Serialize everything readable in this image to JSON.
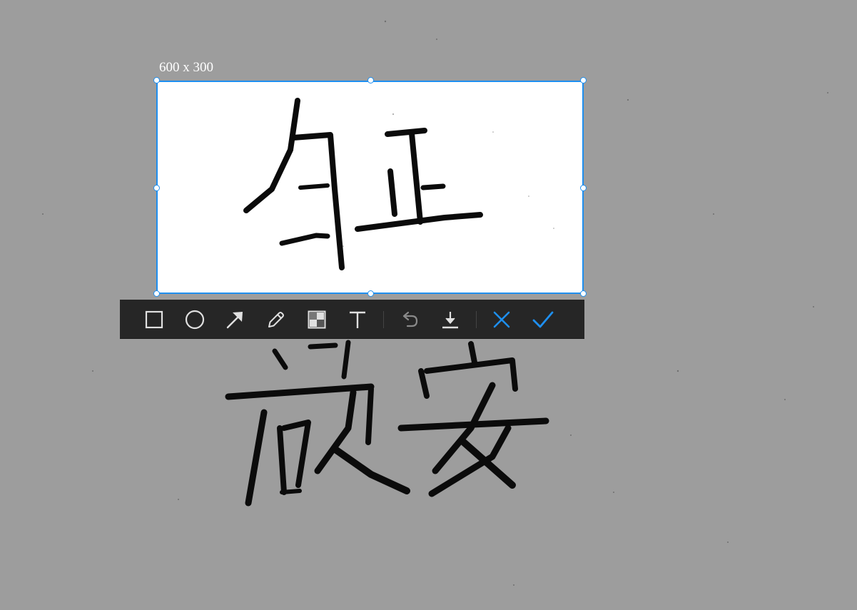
{
  "selection": {
    "size_label": "600 x 300"
  },
  "toolbar": {
    "tools": [
      {
        "name": "rectangle-tool",
        "icon": "square-outline-icon"
      },
      {
        "name": "ellipse-tool",
        "icon": "circle-outline-icon"
      },
      {
        "name": "arrow-tool",
        "icon": "arrow-icon"
      },
      {
        "name": "pen-tool",
        "icon": "pencil-icon"
      },
      {
        "name": "mosaic-tool",
        "icon": "mosaic-icon"
      },
      {
        "name": "text-tool",
        "icon": "text-icon"
      },
      {
        "name": "undo-button",
        "icon": "undo-icon"
      },
      {
        "name": "save-button",
        "icon": "download-icon"
      },
      {
        "name": "cancel-button",
        "icon": "close-icon"
      },
      {
        "name": "confirm-button",
        "icon": "check-icon"
      }
    ]
  },
  "colors": {
    "accent": "#1e8ff0",
    "toolbar_bg": "#262626",
    "icon_light": "#e0e0e0",
    "icon_disabled": "#8a8a8a",
    "backdrop": "#9d9d9d"
  }
}
